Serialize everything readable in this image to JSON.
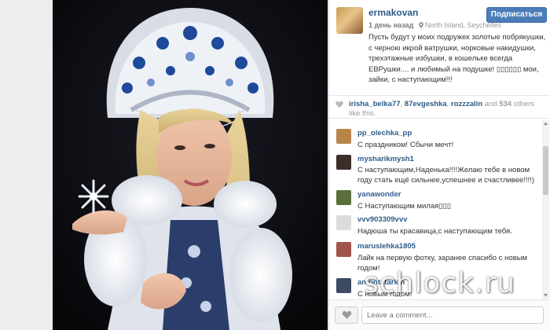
{
  "post": {
    "username": "ermakovan",
    "time": "1 день назад",
    "location": "North Island, Seychelles",
    "follow_label": "Подписаться",
    "caption": "Пусть будут у моих подружек золотые побрякушки, с черною икрой ватрушки, норковые накидушки, трехэтажные избушки, в кошельке всегда ЕВРушки.... и любимый на подушке! ▯▯▯▯▯▯ мои, зайки, с наступающим!!!"
  },
  "likes": {
    "users": [
      "irisha_belka77",
      "87evgeshka",
      "rozzzalin"
    ],
    "sep1": ", ",
    "sep2": ", ",
    "and": " and ",
    "count": "534",
    "suffix": " others like this."
  },
  "comments": [
    {
      "user": "pp_olechka_pp",
      "text": "С праздником! Сбычи мечт!",
      "avatar_color": "#b8864a"
    },
    {
      "user": "mysharikmysh1",
      "text": "С наступающим,Наденька!!!!Желаю тебе в новом году стать ещё сильнее,успешнее и счастливее!!!!)",
      "avatar_color": "#3a2d2a"
    },
    {
      "user": "yanawonder",
      "text": "С Наступающим милая▯▯▯",
      "avatar_color": "#5b6f3c"
    },
    {
      "user": "vvv903309vvv",
      "text": "Надюша ты красавица,с наступающим тебя.",
      "avatar_color": "#dcdcdc"
    },
    {
      "user": "maruslehka1805",
      "text": "Лайк на первую фотку, заранее спасибо с новым годом!",
      "avatar_color": "#a0554a"
    },
    {
      "user": "antontatarkin",
      "text": "С новым годом!",
      "avatar_color": "#3d4a63"
    }
  ],
  "footer": {
    "comment_placeholder": "Leave a comment..."
  },
  "icons": {
    "location": "pin-icon",
    "likes": "heart-icon",
    "like_button": "heart-outline-icon"
  },
  "colors": {
    "accent": "#4a7db8",
    "username": "#2d5c8a"
  },
  "watermark": "schlock.ru"
}
